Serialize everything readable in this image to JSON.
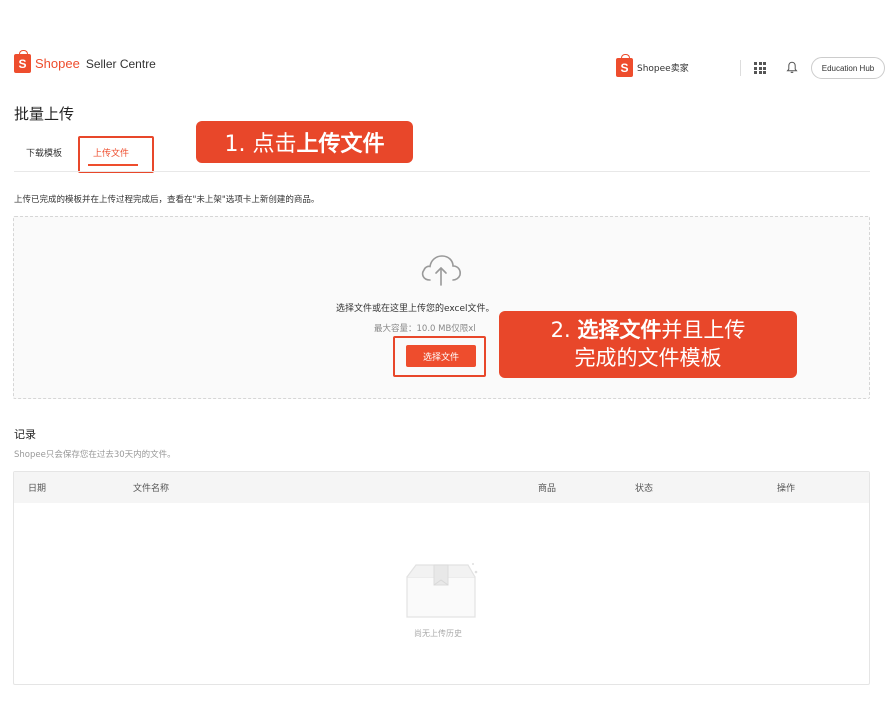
{
  "header": {
    "brand_logo_letter": "S",
    "brand_shopee": "Shopee",
    "brand_seller_centre": "Seller Centre",
    "seller_brand_letter": "S",
    "seller_brand_label": "Shopee卖家",
    "education_hub": "Education Hub"
  },
  "page": {
    "title": "批量上传",
    "tabs": [
      {
        "label": "下载模板"
      },
      {
        "label": "上传文件"
      }
    ],
    "upload_hint": "上传已完成的模板并在上传过程完成后，查看在\"未上架\"选项卡上新创建的商品。"
  },
  "callouts": {
    "step1_prefix": "1. 点击",
    "step1_bold": "上传文件",
    "step2_prefix": "2. ",
    "step2_bold": "选择文件",
    "step2_line1_rest": "并且上传",
    "step2_line2": "完成的文件模板"
  },
  "dropzone": {
    "text": "选择文件或在这里上传您的excel文件。",
    "sub": "最大容量：10.0 MB仅限xl",
    "button": "选择文件"
  },
  "records": {
    "title": "记录",
    "subtitle": "Shopee只会保存您在过去30天内的文件。",
    "columns": [
      "日期",
      "文件名称",
      "商品",
      "状态",
      "操作"
    ],
    "empty_text": "尚无上传历史"
  },
  "colors": {
    "accent": "#ee4d2d",
    "callout": "#e8472a"
  }
}
